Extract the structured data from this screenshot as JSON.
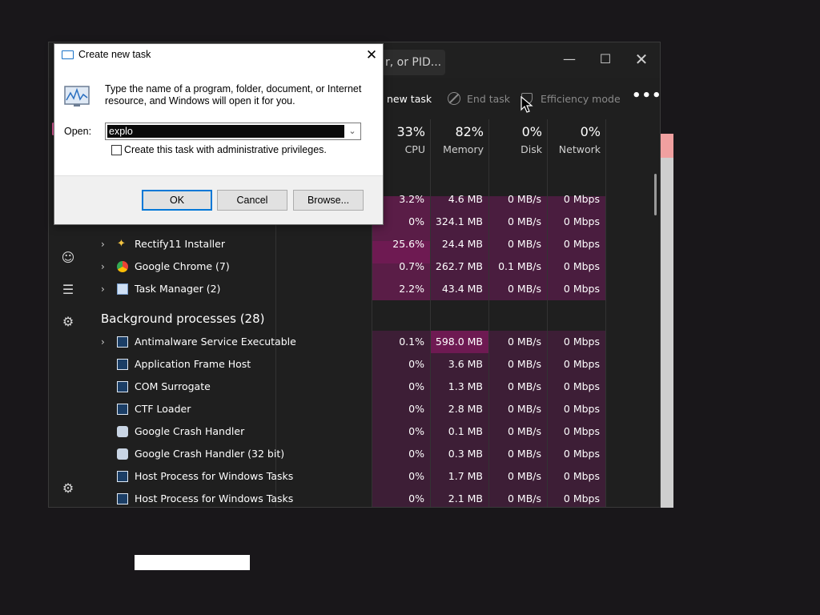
{
  "task_manager": {
    "search_placeholder": "r, or PID...",
    "toolbar": {
      "new_task": "new task",
      "end_task": "End task",
      "efficiency_mode": "Efficiency mode",
      "more": "•••"
    },
    "columns": {
      "cpu": {
        "pct": "33%",
        "label": "CPU"
      },
      "memory": {
        "pct": "82%",
        "label": "Memory"
      },
      "disk": {
        "pct": "0%",
        "label": "Disk"
      },
      "network": {
        "pct": "0%",
        "label": "Network"
      }
    },
    "app_rows": [
      {
        "name": "",
        "cpu": "3.2%",
        "mem": "4.6 MB",
        "disk": "0 MB/s",
        "net": "0 Mbps"
      },
      {
        "name": "",
        "cpu": "0%",
        "mem": "324.1 MB",
        "disk": "0 MB/s",
        "net": "0 Mbps"
      },
      {
        "name": "Rectify11 Installer",
        "cpu": "25.6%",
        "mem": "24.4 MB",
        "disk": "0 MB/s",
        "net": "0 Mbps"
      },
      {
        "name": "Google Chrome (7)",
        "cpu": "0.7%",
        "mem": "262.7 MB",
        "disk": "0.1 MB/s",
        "net": "0 Mbps"
      },
      {
        "name": "Task Manager (2)",
        "cpu": "2.2%",
        "mem": "43.4 MB",
        "disk": "0 MB/s",
        "net": "0 Mbps"
      }
    ],
    "background_header": "Background processes (28)",
    "bg_rows": [
      {
        "name": "Antimalware Service Executable",
        "cpu": "0.1%",
        "mem": "598.0 MB",
        "disk": "0 MB/s",
        "net": "0 Mbps"
      },
      {
        "name": "Application Frame Host",
        "cpu": "0%",
        "mem": "3.6 MB",
        "disk": "0 MB/s",
        "net": "0 Mbps"
      },
      {
        "name": "COM Surrogate",
        "cpu": "0%",
        "mem": "1.3 MB",
        "disk": "0 MB/s",
        "net": "0 Mbps"
      },
      {
        "name": "CTF Loader",
        "cpu": "0%",
        "mem": "2.8 MB",
        "disk": "0 MB/s",
        "net": "0 Mbps"
      },
      {
        "name": "Google Crash Handler",
        "cpu": "0%",
        "mem": "0.1 MB",
        "disk": "0 MB/s",
        "net": "0 Mbps"
      },
      {
        "name": "Google Crash Handler (32 bit)",
        "cpu": "0%",
        "mem": "0.3 MB",
        "disk": "0 MB/s",
        "net": "0 Mbps"
      },
      {
        "name": "Host Process for Windows Tasks",
        "cpu": "0%",
        "mem": "1.7 MB",
        "disk": "0 MB/s",
        "net": "0 Mbps"
      },
      {
        "name": "Host Process for Windows Tasks",
        "cpu": "0%",
        "mem": "2.1 MB",
        "disk": "0 MB/s",
        "net": "0 Mbps"
      }
    ]
  },
  "run_dialog": {
    "title": "Create new task",
    "description": "Type the name of a program, folder, document, or Internet resource, and Windows will open it for you.",
    "open_label": "Open:",
    "input_value": "explo",
    "checkbox_label": "Create this task with administrative privileges.",
    "ok": "OK",
    "cancel": "Cancel",
    "browse": "Browse..."
  },
  "colors": {
    "heat_low": "#3d1e36",
    "heat_mid": "#5a1d47",
    "heat_high": "#6e1a52",
    "accent": "#0078d7"
  }
}
